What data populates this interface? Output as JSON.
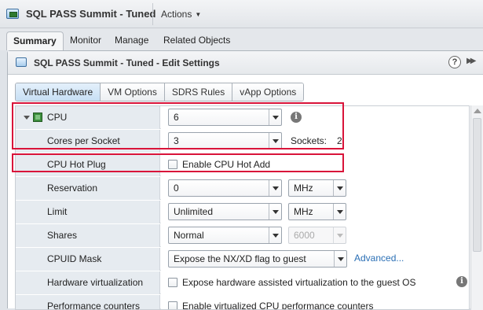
{
  "header": {
    "vm_title": "SQL PASS Summit - Tuned",
    "actions_label": "Actions"
  },
  "tabs": [
    {
      "label": "Summary",
      "active": true
    },
    {
      "label": "Monitor"
    },
    {
      "label": "Manage"
    },
    {
      "label": "Related Objects"
    }
  ],
  "dialog": {
    "title": "SQL PASS Summit - Tuned - Edit Settings",
    "help": "?",
    "subtabs": [
      {
        "label": "Virtual Hardware",
        "active": true
      },
      {
        "label": "VM Options"
      },
      {
        "label": "SDRS Rules"
      },
      {
        "label": "vApp Options"
      }
    ]
  },
  "settings": {
    "cpu": {
      "label": "CPU",
      "value": "6"
    },
    "cores_per_socket": {
      "label": "Cores per Socket",
      "value": "3",
      "sockets_label": "Sockets:",
      "sockets_value": "2"
    },
    "cpu_hot_plug": {
      "label": "CPU Hot Plug",
      "option": "Enable CPU Hot Add",
      "checked": false
    },
    "reservation": {
      "label": "Reservation",
      "value": "0",
      "unit": "MHz"
    },
    "limit": {
      "label": "Limit",
      "value": "Unlimited",
      "unit": "MHz"
    },
    "shares": {
      "label": "Shares",
      "value": "Normal",
      "amount": "6000"
    },
    "cpuid_mask": {
      "label": "CPUID Mask",
      "value": "Expose the NX/XD flag to guest",
      "advanced_link": "Advanced..."
    },
    "hardware_virtualization": {
      "label": "Hardware virtualization",
      "option": "Expose hardware assisted virtualization to the guest OS",
      "checked": false
    },
    "performance_counters": {
      "label": "Performance counters",
      "option": "Enable virtualized CPU performance counters",
      "checked": false
    }
  },
  "info_glyph": "i",
  "colors": {
    "highlight": "#d9143a",
    "link": "#2a6fb5",
    "label_bg": "#e6ebf0"
  }
}
